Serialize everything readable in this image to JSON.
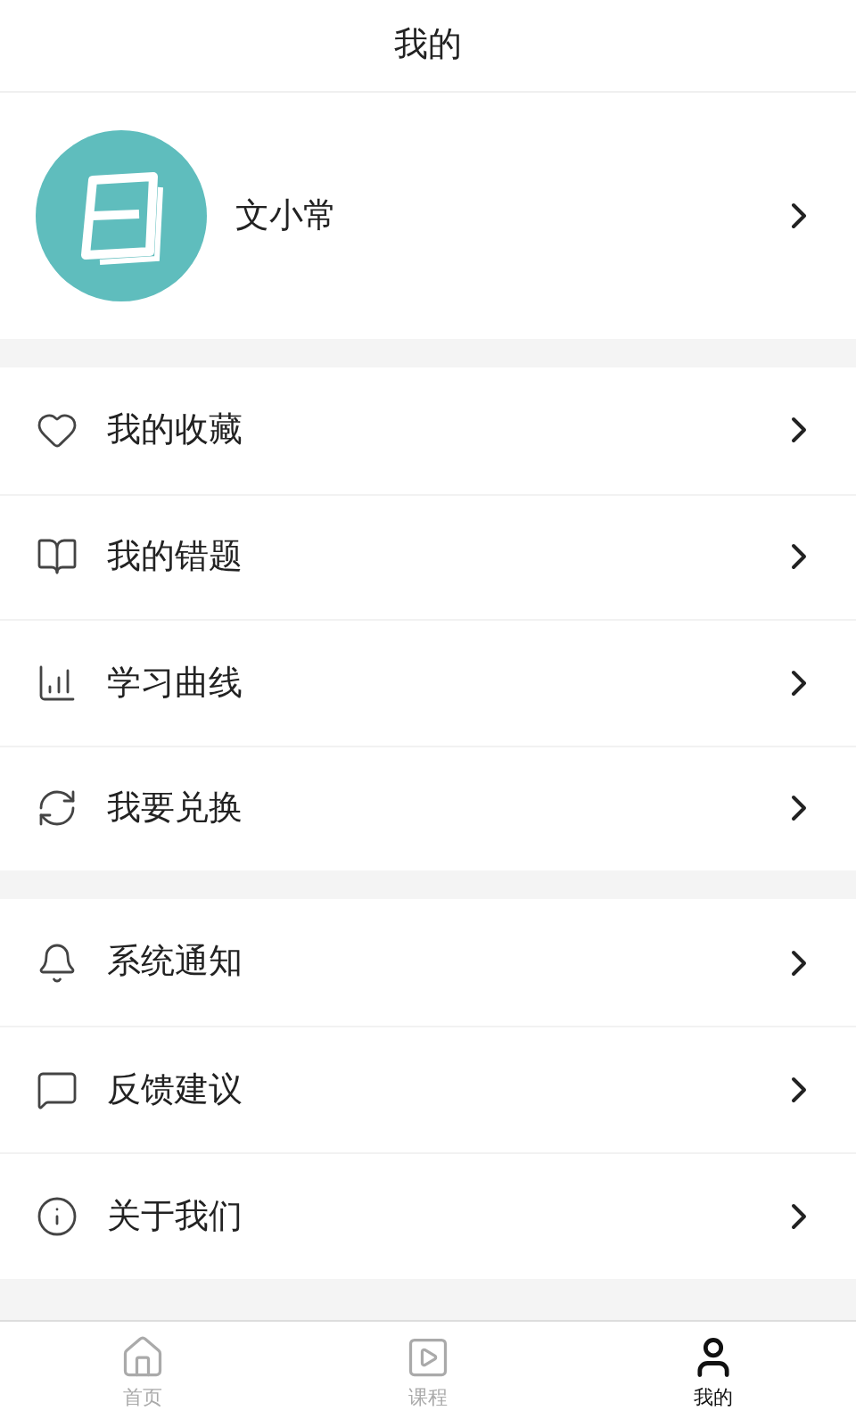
{
  "header": {
    "title": "我的"
  },
  "profile": {
    "name": "文小常"
  },
  "menu_groups": [
    [
      {
        "kind": "favorite",
        "label": "我的收藏"
      },
      {
        "kind": "mistakes",
        "label": "我的错题"
      },
      {
        "kind": "curve",
        "label": "学习曲线"
      },
      {
        "kind": "redeem",
        "label": "我要兑换"
      }
    ],
    [
      {
        "kind": "notice",
        "label": "系统通知"
      },
      {
        "kind": "feedback",
        "label": "反馈建议"
      },
      {
        "kind": "about",
        "label": "关于我们"
      }
    ]
  ],
  "tab_bar": [
    {
      "kind": "home",
      "label": "首页",
      "selected": false
    },
    {
      "kind": "course",
      "label": "课程",
      "selected": false
    },
    {
      "kind": "me",
      "label": "我的",
      "selected": true
    }
  ]
}
